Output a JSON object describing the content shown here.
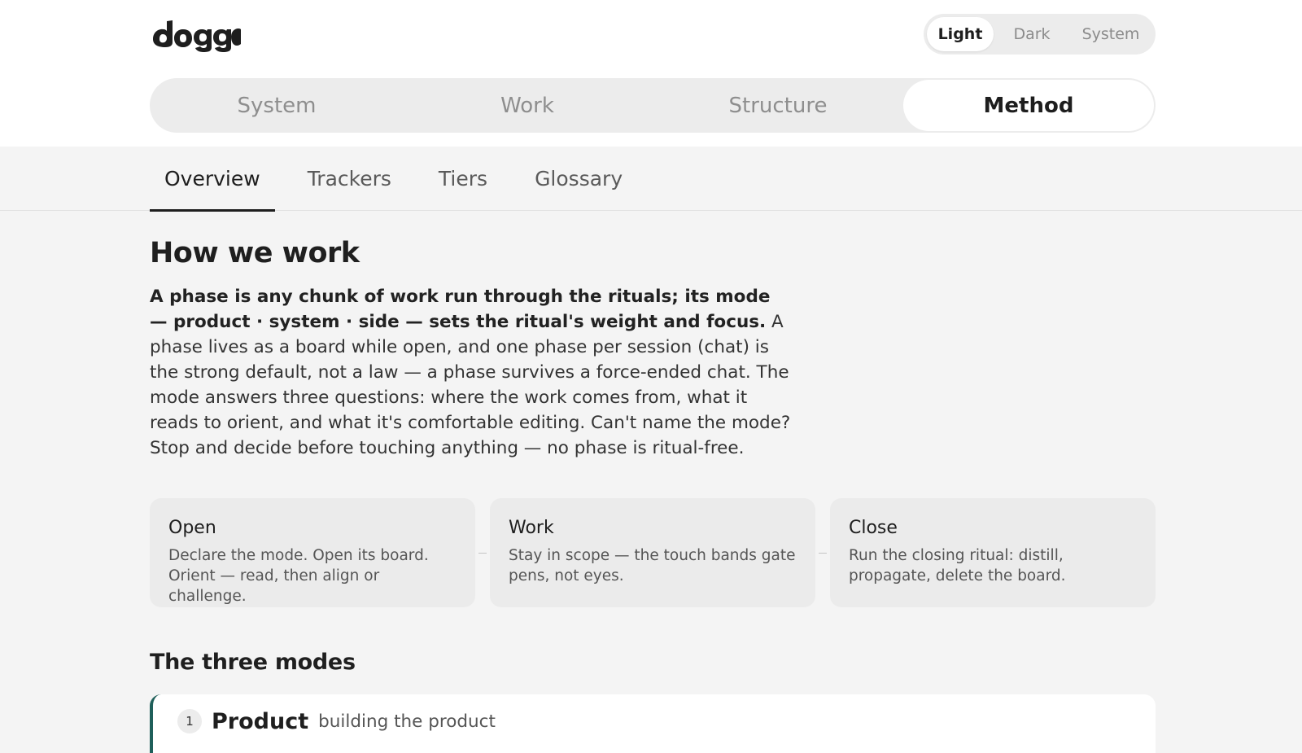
{
  "brand": {
    "logo_text": "doggo"
  },
  "theme": {
    "options": [
      "Light",
      "Dark",
      "System"
    ],
    "selected": "Light"
  },
  "main_nav": {
    "tabs": [
      "System",
      "Work",
      "Structure",
      "Method"
    ],
    "selected": "Method"
  },
  "sub_nav": {
    "tabs": [
      "Overview",
      "Trackers",
      "Tiers",
      "Glossary"
    ],
    "selected": "Overview"
  },
  "page": {
    "title": "How we work",
    "intro_bold": "A phase is any chunk of work run through the rituals; its mode — product · system · side — sets the ritual's weight and focus.",
    "intro_rest": " A phase lives as a board while open, and one phase per session (chat) is the strong default, not a law — a phase survives a force-ended chat. The mode answers three questions: where the work comes from, what it reads to orient, and what it's comfortable editing. Can't name the mode? Stop and decide before touching anything — no phase is ritual-free."
  },
  "steps": [
    {
      "title": "Open",
      "desc": "Declare the mode. Open its board. Orient — read, then align or challenge."
    },
    {
      "title": "Work",
      "desc": "Stay in scope — the touch bands gate pens, not eyes."
    },
    {
      "title": "Close",
      "desc": "Run the closing ritual: distill, propagate, delete the board."
    }
  ],
  "modes_section": {
    "title": "The three modes",
    "modes": [
      {
        "num": "1",
        "name": "Product",
        "desc": "building the product"
      }
    ]
  },
  "colors": {
    "accent": "#1f5f5a",
    "page_bg": "#f4f4f4",
    "card_bg": "#ebebeb"
  }
}
